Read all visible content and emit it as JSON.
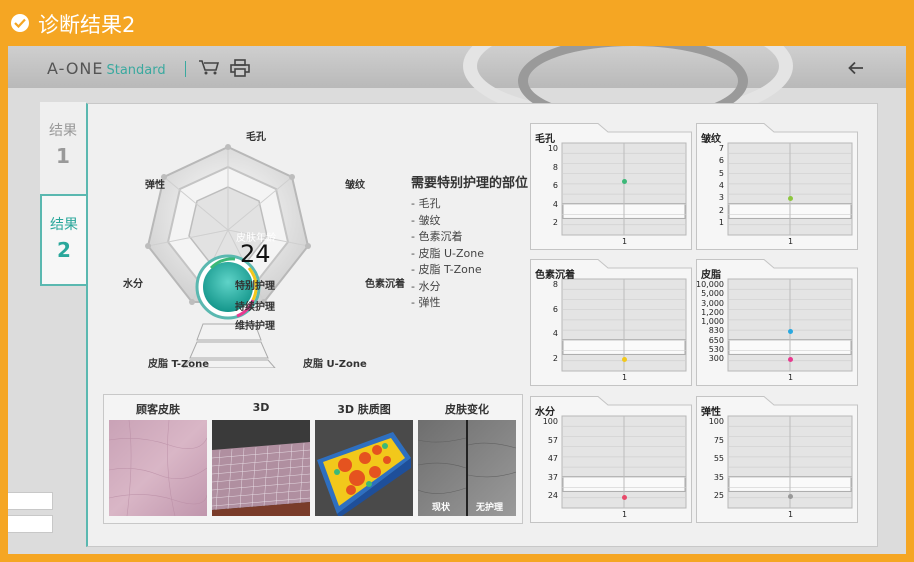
{
  "window": {
    "title": "诊断结果2"
  },
  "header": {
    "brand_main": "A-ONE",
    "brand_sub": "Standard"
  },
  "tabs": [
    {
      "label": "结果",
      "number": "1"
    },
    {
      "label": "结果",
      "number": "2"
    }
  ],
  "radar": {
    "axes": [
      "毛孔",
      "皱纹",
      "色素沉着",
      "皮脂 U-Zone",
      "皮脂 T-Zone",
      "水分",
      "弹性"
    ],
    "center_label": "皮肤年龄",
    "center_value": "24",
    "levels": [
      "特别护理",
      "持续护理",
      "维持护理"
    ]
  },
  "care": {
    "title": "需要特别护理的部位",
    "items": [
      "- 毛孔",
      "- 皱纹",
      "- 色素沉着",
      "- 皮脂 U-Zone",
      "- 皮脂 T-Zone",
      "- 水分",
      "- 弹性"
    ]
  },
  "photos": {
    "labels": [
      "顾客皮肤",
      "3D",
      "3D 肤质图",
      "皮肤变化"
    ],
    "change_left": "现状",
    "change_right": "无护理"
  },
  "chart_data": [
    {
      "type": "scatter",
      "title": "毛孔",
      "categories": [
        "1"
      ],
      "y_ticks": [
        "10",
        "8",
        "6",
        "4",
        "2"
      ],
      "values": [
        6.5
      ],
      "point_color": "#3cb878"
    },
    {
      "type": "scatter",
      "title": "皱纹",
      "categories": [
        "1"
      ],
      "y_ticks": [
        "7",
        "6",
        "5",
        "4",
        "3",
        "2",
        "1"
      ],
      "values": [
        3
      ],
      "point_color": "#8dc63f"
    },
    {
      "type": "scatter",
      "title": "色素沉着",
      "categories": [
        "1"
      ],
      "y_ticks": [
        "8",
        "6",
        "4",
        "2"
      ],
      "values": [
        2
      ],
      "point_color": "#f2c81b"
    },
    {
      "type": "scatter",
      "title": "皮脂",
      "categories": [
        "1"
      ],
      "y_ticks": [
        "10,000",
        "5,000",
        "3,000",
        "1,200",
        "1,000",
        "830",
        "650",
        "530",
        "300"
      ],
      "values": [
        "830",
        "300"
      ],
      "point_colors": [
        "#29a8e0",
        "#e8398f"
      ]
    },
    {
      "type": "scatter",
      "title": "水分",
      "categories": [
        "1"
      ],
      "y_ticks": [
        "100",
        "57",
        "47",
        "37",
        "24"
      ],
      "values": [
        21
      ],
      "point_color": "#e84a6a"
    },
    {
      "type": "scatter",
      "title": "弹性",
      "categories": [
        "1"
      ],
      "y_ticks": [
        "100",
        "75",
        "55",
        "35",
        "25"
      ],
      "values": [
        22
      ],
      "point_color": "#999999"
    }
  ]
}
